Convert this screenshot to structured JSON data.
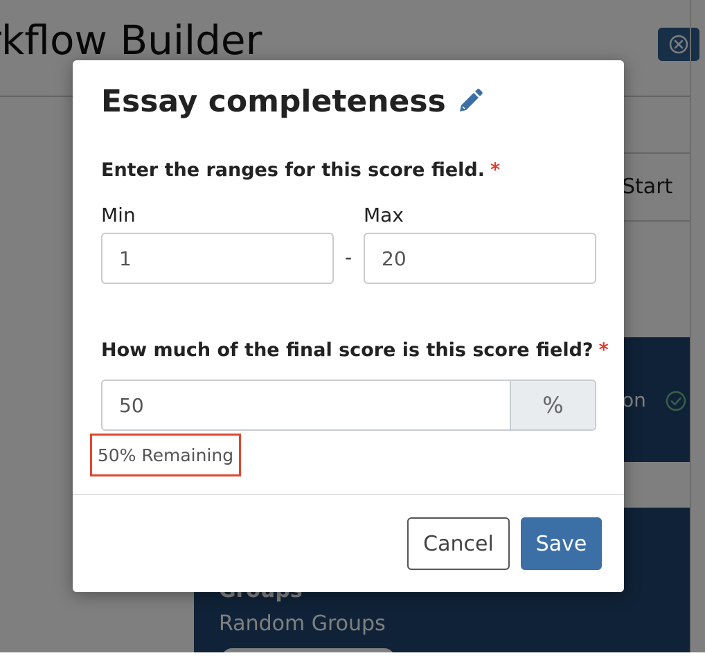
{
  "background": {
    "page_title": "rkflow Builder",
    "close_icon": "close-circle-icon",
    "start_card_label": "Start",
    "blue_card_text": "on",
    "check_icon": "check-circle-icon",
    "groups_label": "Groups",
    "random_groups_label": "Random Groups"
  },
  "modal": {
    "title": "Essay completeness",
    "edit_icon": "pencil-icon",
    "ranges_label": "Enter the ranges for this score field.",
    "required_marker": "*",
    "min_label": "Min",
    "min_value": "1",
    "separator": "-",
    "max_label": "Max",
    "max_value": "20",
    "weight_label": "How much of the final score is this score field?",
    "weight_value": "50",
    "weight_unit": "%",
    "remaining_text": "50% Remaining",
    "cancel_label": "Cancel",
    "save_label": "Save"
  },
  "colors": {
    "primary": "#3b6fa6",
    "card_blue": "#20456f",
    "required": "#e03a2f",
    "highlight_border": "#e0472f"
  }
}
